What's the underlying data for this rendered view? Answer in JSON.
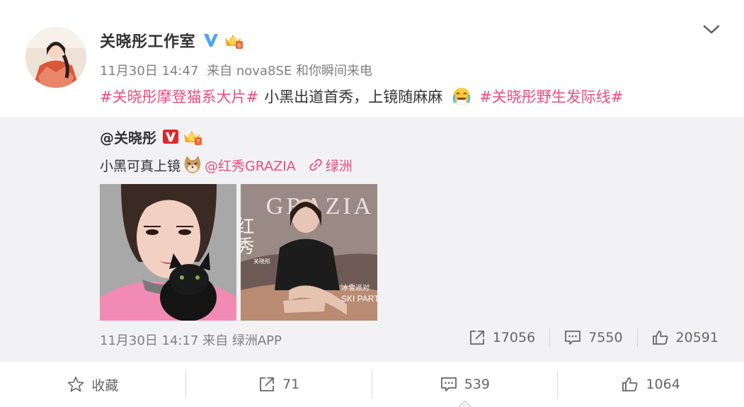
{
  "post": {
    "author": "关晓彤工作室",
    "time": "11月30日 14:47",
    "source": "来自 nova8SE 和你瞬间来电",
    "topic1": "#关晓彤摩登猫系大片#",
    "text": "小黑出道首秀，上镜随麻麻",
    "emoji1": "cry-laugh-emoji",
    "topic2": "#关晓彤野生发际线#"
  },
  "repost": {
    "author": "@关晓彤",
    "text": "小黑可真上镜",
    "mention": "@红秀GRAZIA",
    "link": "绿洲",
    "images": [
      {
        "subject": "portrait-with-black-cat"
      },
      {
        "subject": "grazia-magazine-cover",
        "mag_cn": "红秀",
        "mag_en": "GRAZIA",
        "person": "关晓彤",
        "tag_cn": "冰雪派对",
        "tag_en": "SKI PARTY"
      }
    ],
    "time": "11月30日 14:17",
    "source": "来自 绿洲APP",
    "stats": {
      "repost": "17056",
      "comment": "7550",
      "like": "20591"
    }
  },
  "actions": {
    "favorite": "收藏",
    "repost": "71",
    "comment": "539",
    "like": "1064"
  },
  "colors": {
    "topic": "#e84e7e",
    "meta": "#808080",
    "repost_bg": "#f2f2f5",
    "verified": "#4fa3f7",
    "verified_red": "#e0262d"
  }
}
